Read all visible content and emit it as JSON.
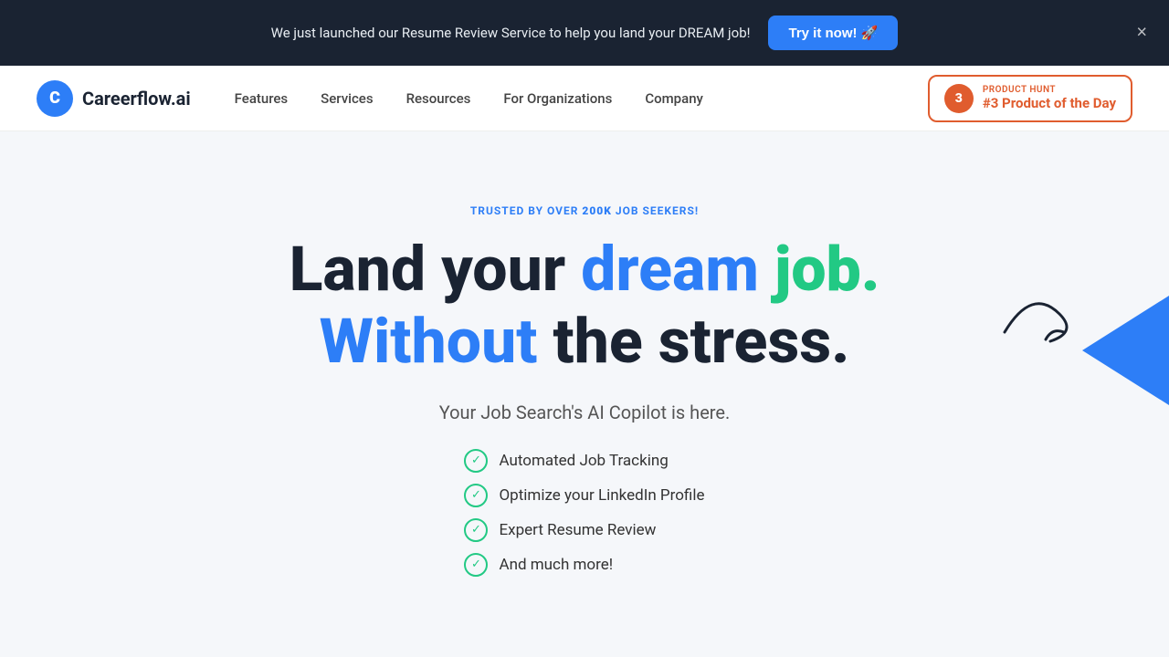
{
  "banner": {
    "text": "We just launched our Resume Review Service to help you land your DREAM job!",
    "cta_label": "Try it now! 🚀",
    "close_label": "×"
  },
  "navbar": {
    "logo_letter": "C",
    "logo_name": "Careerflow.ai",
    "nav_items": [
      {
        "label": "Features"
      },
      {
        "label": "Services"
      },
      {
        "label": "Resources"
      },
      {
        "label": "For Organizations"
      },
      {
        "label": "Company"
      }
    ],
    "product_hunt": {
      "pre_label": "PRODUCT HUNT",
      "label": "#3 Product of the Day",
      "number": "3"
    }
  },
  "hero": {
    "trusted_pre": "TRUSTED BY OVER ",
    "trusted_highlight": "200K",
    "trusted_post": " JOB SEEKERS!",
    "heading_line1_pre": "Land your ",
    "heading_line1_dream": "dream",
    "heading_line1_post": " job.",
    "heading_line2_without": "Without",
    "heading_line2_post": " the stress.",
    "subtext": "Your Job Search's AI Copilot is here.",
    "features": [
      "Automated Job Tracking",
      "Optimize your LinkedIn Profile",
      "Expert Resume Review",
      "And much more!"
    ]
  }
}
